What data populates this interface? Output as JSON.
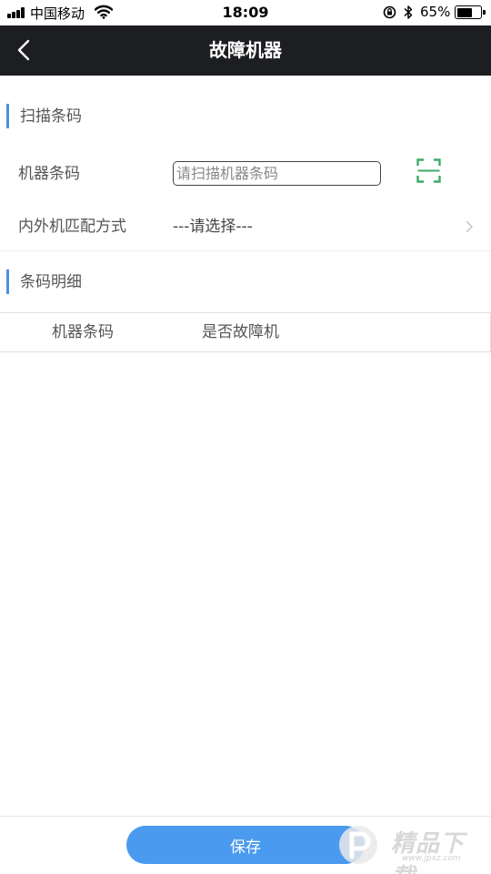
{
  "status_bar": {
    "carrier": "中国移动",
    "time": "18:09",
    "battery_percent": "65%",
    "battery_level": 0.65,
    "icons": [
      "signal-icon",
      "wifi-icon",
      "rotation-lock-icon",
      "bluetooth-icon",
      "battery-icon"
    ]
  },
  "nav": {
    "title": "故障机器",
    "back_icon": "chevron-left-icon"
  },
  "scan_section": {
    "title": "扫描条码",
    "barcode_label": "机器条码",
    "barcode_value": "",
    "barcode_placeholder": "请扫描机器条码",
    "scan_icon": "scan-icon",
    "match_label": "内外机匹配方式",
    "match_value": "---请选择---"
  },
  "detail_section": {
    "title": "条码明细",
    "columns": [
      "机器条码",
      "是否故障机"
    ]
  },
  "footer": {
    "save_label": "保存"
  },
  "watermark": {
    "text": "精品下载",
    "url": "www.jpxz.com"
  },
  "colors": {
    "nav_background": "#1d1e22",
    "accent": "#4a90e2",
    "button": "#4a9bf0",
    "scan_icon": "#3daa6a"
  }
}
